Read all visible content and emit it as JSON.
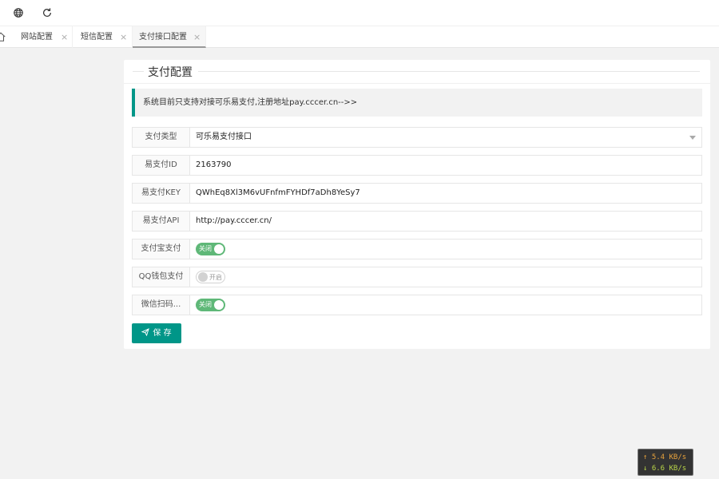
{
  "topbar": {
    "icons": [
      "globe-icon",
      "refresh-icon"
    ]
  },
  "tabs": [
    {
      "label": "网站配置",
      "close": "×",
      "active": false
    },
    {
      "label": "短信配置",
      "close": "×",
      "active": false
    },
    {
      "label": "支付接口配置",
      "close": "×",
      "active": true
    }
  ],
  "card": {
    "legend": "支付配置",
    "notice": "系统目前只支持对接可乐易支付,注册地址pay.cccer.cn-->>"
  },
  "form": {
    "pay_type": {
      "label": "支付类型",
      "value": "可乐易支付接口"
    },
    "epay_id": {
      "label": "易支付ID",
      "value": "2163790"
    },
    "epay_key": {
      "label": "易支付KEY",
      "value": "QWhEq8Xl3M6vUFnfmFYHDf7aDh8YeSy7"
    },
    "epay_api": {
      "label": "易支付API",
      "value": "http://pay.cccer.cn/"
    },
    "alipay": {
      "label": "支付宝支付",
      "switch_text": "关闭",
      "on": true
    },
    "qqpay": {
      "label": "QQ钱包支付",
      "switch_text": "开启",
      "on": false
    },
    "wxpay": {
      "label": "微信扫码...",
      "switch_text": "关闭",
      "on": true
    },
    "save_label": "保 存"
  },
  "netspeed": {
    "up": "↑ 5.4 KB/s",
    "down": "↓ 6.6 KB/s"
  },
  "colors": {
    "accent": "#009688",
    "switch_on": "#5fb878",
    "background": "#f2f2f2"
  }
}
